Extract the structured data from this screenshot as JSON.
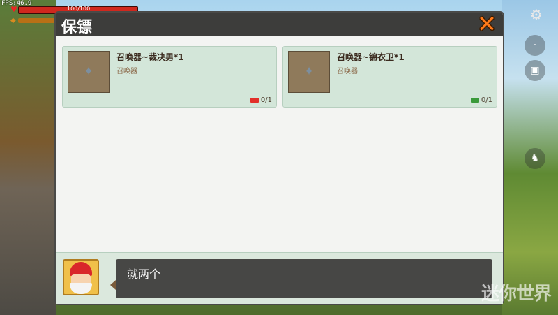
{
  "hud": {
    "fps": "FPS:46.9",
    "hp": "100/100",
    "hp_fraction": 1.0
  },
  "panel": {
    "title": "保镖",
    "close_icon": "close-icon"
  },
  "items": [
    {
      "name": "召唤器~裁决男*1",
      "type": "召唤器",
      "count": "0/1",
      "ticket_color": "#e2302a"
    },
    {
      "name": "召唤器~锦衣卫*1",
      "type": "召唤器",
      "count": "0/1",
      "ticket_color": "#3a9a3a"
    }
  ],
  "dialog": {
    "text": "就两个"
  },
  "watermark": "迷你世界"
}
